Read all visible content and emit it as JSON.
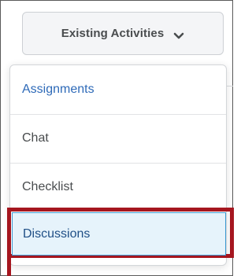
{
  "dropdown": {
    "label": "Existing Activities",
    "icon": "chevron-down-icon"
  },
  "menu": {
    "items": [
      {
        "label": "Assignments"
      },
      {
        "label": "Chat"
      },
      {
        "label": "Checklist"
      },
      {
        "label": "Discussions",
        "selected": true
      }
    ]
  },
  "colors": {
    "accent_link": "#2e6ab8",
    "selected_bg": "#e6f3fb",
    "selected_border": "#3e9bd3",
    "highlight_border": "#a5161f"
  }
}
